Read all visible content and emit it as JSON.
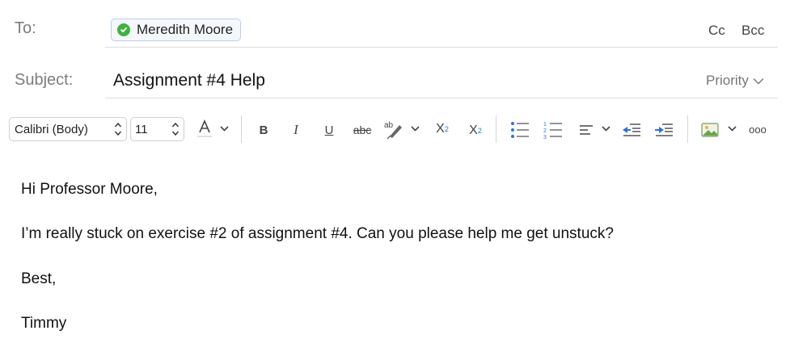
{
  "header": {
    "to_label": "To:",
    "recipient": {
      "name": "Meredith Moore",
      "verified": true
    },
    "cc_label": "Cc",
    "bcc_label": "Bcc",
    "subject_label": "Subject:",
    "subject_value": "Assignment #4 Help",
    "priority_label": "Priority"
  },
  "toolbar": {
    "font_name": "Calibri (Body)",
    "font_size": "11",
    "bold": "B",
    "italic": "I",
    "underline": "U",
    "strikethrough": "abc",
    "superscript_base": "X",
    "superscript_mark": "2",
    "subscript_base": "X",
    "subscript_mark": "2",
    "more": "ooo",
    "icons": [
      "font-color-icon",
      "chevron-down-icon",
      "highlighter-icon",
      "bulleted-list-icon",
      "numbered-list-icon",
      "align-left-icon",
      "decrease-indent-icon",
      "increase-indent-icon",
      "insert-picture-icon"
    ]
  },
  "message": {
    "greeting": "Hi Professor Moore,",
    "paragraph": "I’m really stuck on exercise #2 of assignment #4. Can you please help me get unstuck?",
    "closing": "Best,",
    "signature": "Timmy"
  },
  "colors": {
    "accent_check": "#3fb33f",
    "chip_border": "#b9cfe8",
    "indent_blue": "#2a74d8"
  }
}
